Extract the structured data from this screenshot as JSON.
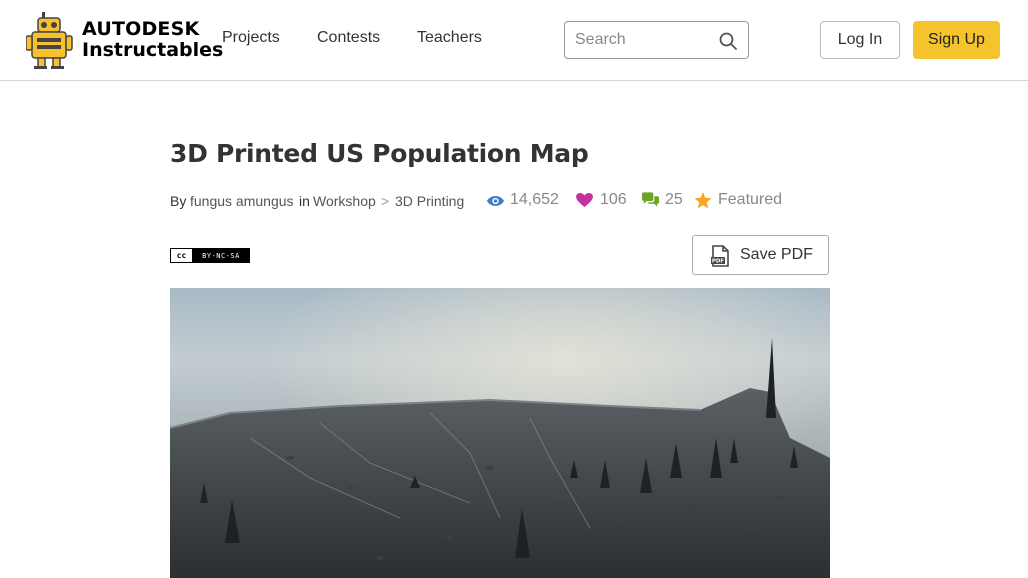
{
  "header": {
    "brand_line1": "AUTODESK",
    "brand_line2": "Instructables",
    "nav": [
      "Projects",
      "Contests",
      "Teachers"
    ],
    "search": {
      "placeholder": "Search"
    },
    "login_label": "Log In",
    "signup_label": "Sign Up",
    "signup_color": "#f5c32c"
  },
  "article": {
    "title": "3D Printed US Population Map",
    "by_label": "By",
    "author": "fungus amungus",
    "in_label": "in",
    "category": "Workshop",
    "separator": ">",
    "subcategory": "3D Printing",
    "views": "14,652",
    "favorites": "106",
    "comments": "25",
    "featured_label": "Featured",
    "license": {
      "badge": "cc",
      "text": "BY-NC-SA"
    },
    "save_pdf_label": "Save PDF",
    "icons": {
      "views": "eye-icon",
      "favorites": "heart-icon",
      "comments": "comments-icon",
      "featured": "star-icon",
      "pdf": "pdf-file-icon"
    },
    "colors": {
      "views": "#3f7ec7",
      "favorites": "#c62f9f",
      "comments": "#6fa32c",
      "featured": "#f5a623"
    }
  }
}
